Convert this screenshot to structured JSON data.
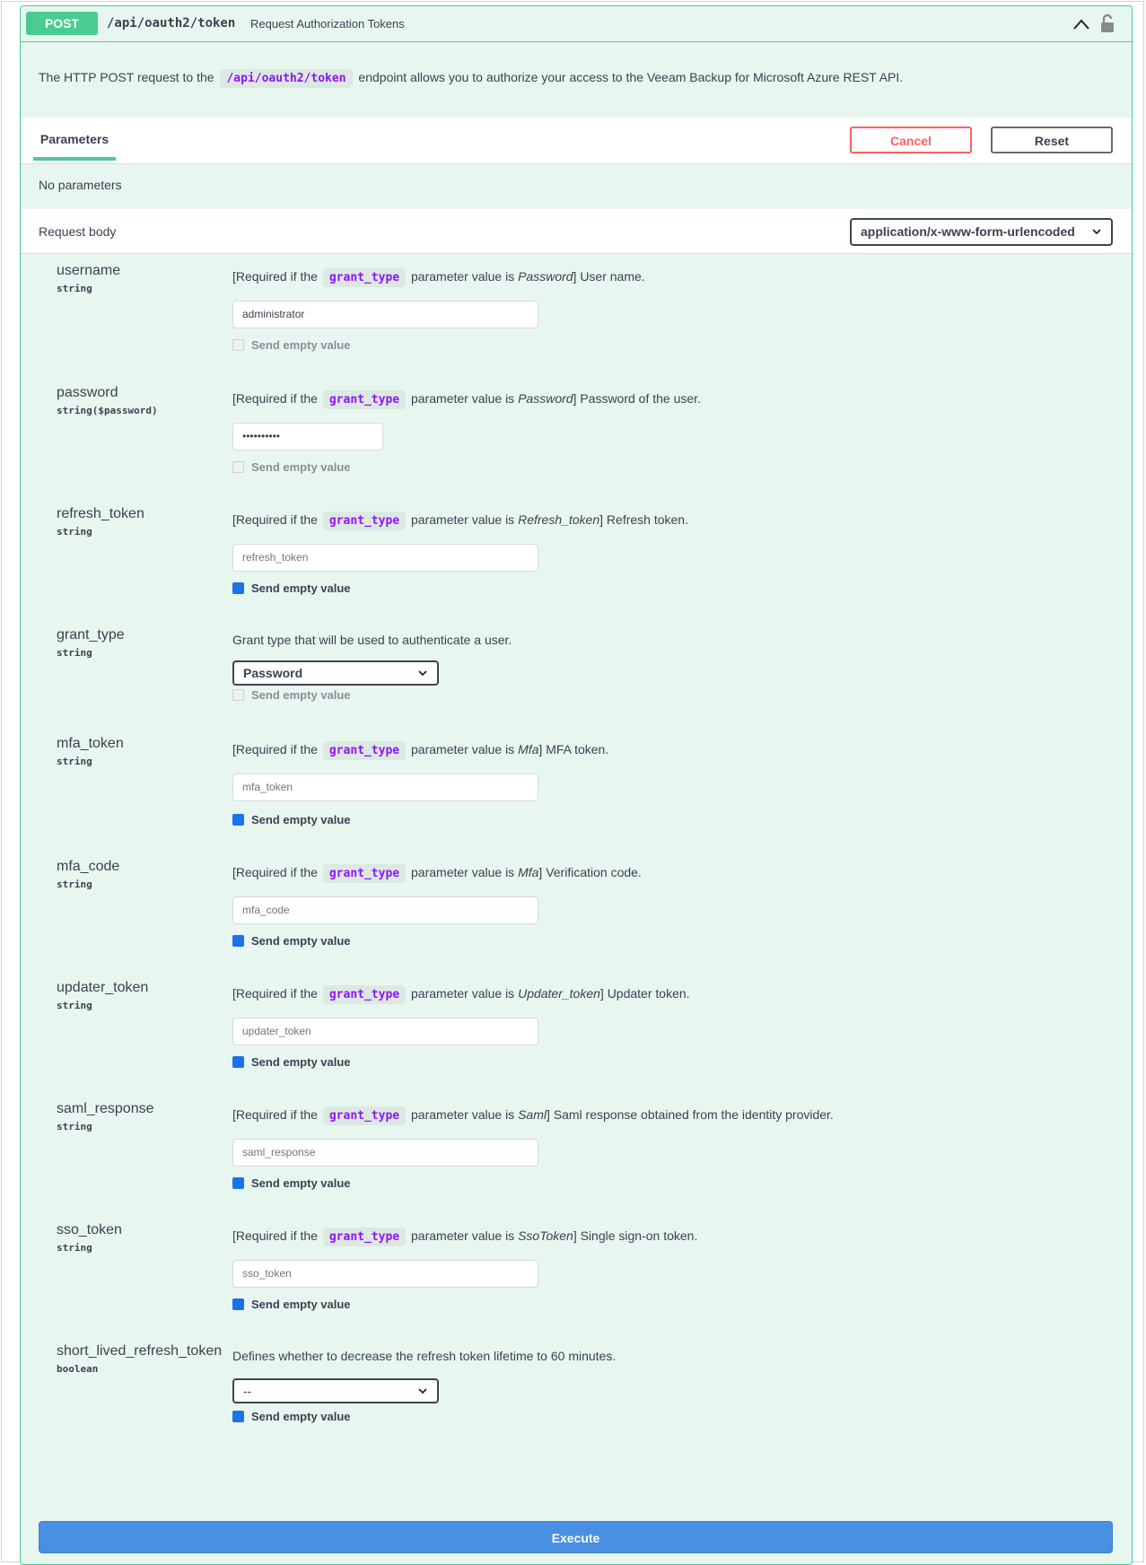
{
  "summary": {
    "method": "POST",
    "path": "/api/oauth2/token",
    "description": "Request Authorization Tokens"
  },
  "description": {
    "before": "The HTTP POST request to the",
    "code": "/api/oauth2/token",
    "after": "endpoint allows you to authorize your access to the Veeam Backup for Microsoft Azure REST API."
  },
  "tabs": {
    "parameters": "Parameters"
  },
  "buttons": {
    "cancel": "Cancel",
    "reset": "Reset",
    "execute": "Execute"
  },
  "no_parameters": "No parameters",
  "request_body": {
    "label": "Request body",
    "content_type": "application/x-www-form-urlencoded"
  },
  "common": {
    "required_prefix": "[Required if the",
    "grant_type_code": "grant_type",
    "param_value_is": "parameter value is",
    "send_empty": "Send empty value"
  },
  "params": [
    {
      "name": "username",
      "type": "string",
      "value_word": "Password",
      "desc_tail": "] User name.",
      "value": "administrator",
      "placeholder": "",
      "send_empty": false
    },
    {
      "name": "password",
      "type": "string($password)",
      "value_word": "Password",
      "desc_tail": "] Password of the user.",
      "value": "••••••••••",
      "placeholder": "",
      "send_empty": false
    },
    {
      "name": "refresh_token",
      "type": "string",
      "value_word": "Refresh_token",
      "desc_tail": "] Refresh token.",
      "value": "",
      "placeholder": "refresh_token",
      "send_empty": true
    },
    {
      "name": "grant_type",
      "type": "string",
      "description": "Grant type that will be used to authenticate a user.",
      "selected": "Password",
      "send_empty": false
    },
    {
      "name": "mfa_token",
      "type": "string",
      "value_word": "Mfa",
      "desc_tail": "] MFA token.",
      "value": "",
      "placeholder": "mfa_token",
      "send_empty": true
    },
    {
      "name": "mfa_code",
      "type": "string",
      "value_word": "Mfa",
      "desc_tail": "] Verification code.",
      "value": "",
      "placeholder": "mfa_code",
      "send_empty": true
    },
    {
      "name": "updater_token",
      "type": "string",
      "value_word": "Updater_token",
      "desc_tail": "] Updater token.",
      "value": "",
      "placeholder": "updater_token",
      "send_empty": true
    },
    {
      "name": "saml_response",
      "type": "string",
      "value_word": "Saml",
      "desc_tail": "] Saml response obtained from the identity provider.",
      "value": "",
      "placeholder": "saml_response",
      "send_empty": true
    },
    {
      "name": "sso_token",
      "type": "string",
      "value_word": "SsoToken",
      "desc_tail": "] Single sign-on token.",
      "value": "",
      "placeholder": "sso_token",
      "send_empty": true
    },
    {
      "name": "short_lived_refresh_token",
      "type": "boolean",
      "description": "Defines whether to decrease the refresh token lifetime to 60 minutes.",
      "selected": "--",
      "send_empty": true
    }
  ],
  "colors": {
    "post_green": "#49cc90",
    "block_bg": "#e8f6f0",
    "code_purple": "#9012fe",
    "cancel_red": "#ff6060",
    "execute_blue": "#4990e2",
    "checkbox_blue": "#1a73e8"
  },
  "icons": {
    "collapse": "chevron-up-icon",
    "lock": "lock-icon",
    "dropdown": "chevron-down-icon"
  }
}
